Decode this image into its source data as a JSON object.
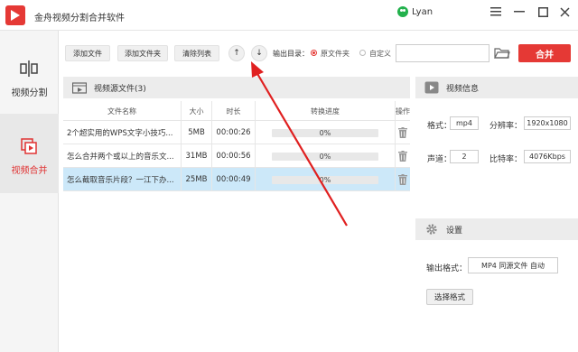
{
  "app": {
    "title": "金舟视频分割合并软件",
    "user_name": "Lyan",
    "min_glyph": "—",
    "max_glyph": "□",
    "close_glyph": "✕",
    "menu_glyph": "☰"
  },
  "sidebar": {
    "items": [
      {
        "label": "视频分割",
        "icon": "split-icon",
        "active": false
      },
      {
        "label": "视频合并",
        "icon": "merge-icon",
        "active": true
      }
    ]
  },
  "toolbar": {
    "add_file": "添加文件",
    "add_folder": "添加文件夹",
    "clear_list": "清除列表",
    "up_glyph": "↑",
    "down_glyph": "↓",
    "output_label": "输出目录：",
    "radio_source": "原文件夹",
    "radio_custom": "自定义",
    "path_value": "",
    "merge_label": "合并"
  },
  "file_list": {
    "header_title": "视频源文件(3)",
    "columns": [
      "文件名称",
      "大小",
      "时长",
      "转换进度",
      "操作"
    ],
    "rows": [
      {
        "name": "2个超实用的WPS文字小技巧...",
        "size": "5MB",
        "duration": "00:00:26",
        "progress": 0,
        "progress_text": "0%",
        "selected": false
      },
      {
        "name": "怎么合并两个或以上的音乐文...",
        "size": "31MB",
        "duration": "00:00:56",
        "progress": 0,
        "progress_text": "0%",
        "selected": false
      },
      {
        "name": "怎么截取音乐片段？一江下办...",
        "size": "25MB",
        "duration": "00:00:49",
        "progress": 0,
        "progress_text": "0%",
        "selected": true
      }
    ]
  },
  "video_info": {
    "header_title": "视频信息",
    "format_label": "格式：",
    "format_value": "mp4",
    "resolution_label": "分辨率：",
    "resolution_value": "1920x1080",
    "channels_label": "声道：",
    "channels_value": "2",
    "bitrate_label": "比特率：",
    "bitrate_value": "4076Kbps"
  },
  "settings": {
    "header_title": "设置",
    "output_format_label": "输出格式：",
    "output_format_value": "MP4 同源文件 自动",
    "choose_format": "选择格式"
  },
  "colors": {
    "accent": "#e53935",
    "selected_row": "#cce8f9",
    "annotation_arrow": "#e02020"
  }
}
